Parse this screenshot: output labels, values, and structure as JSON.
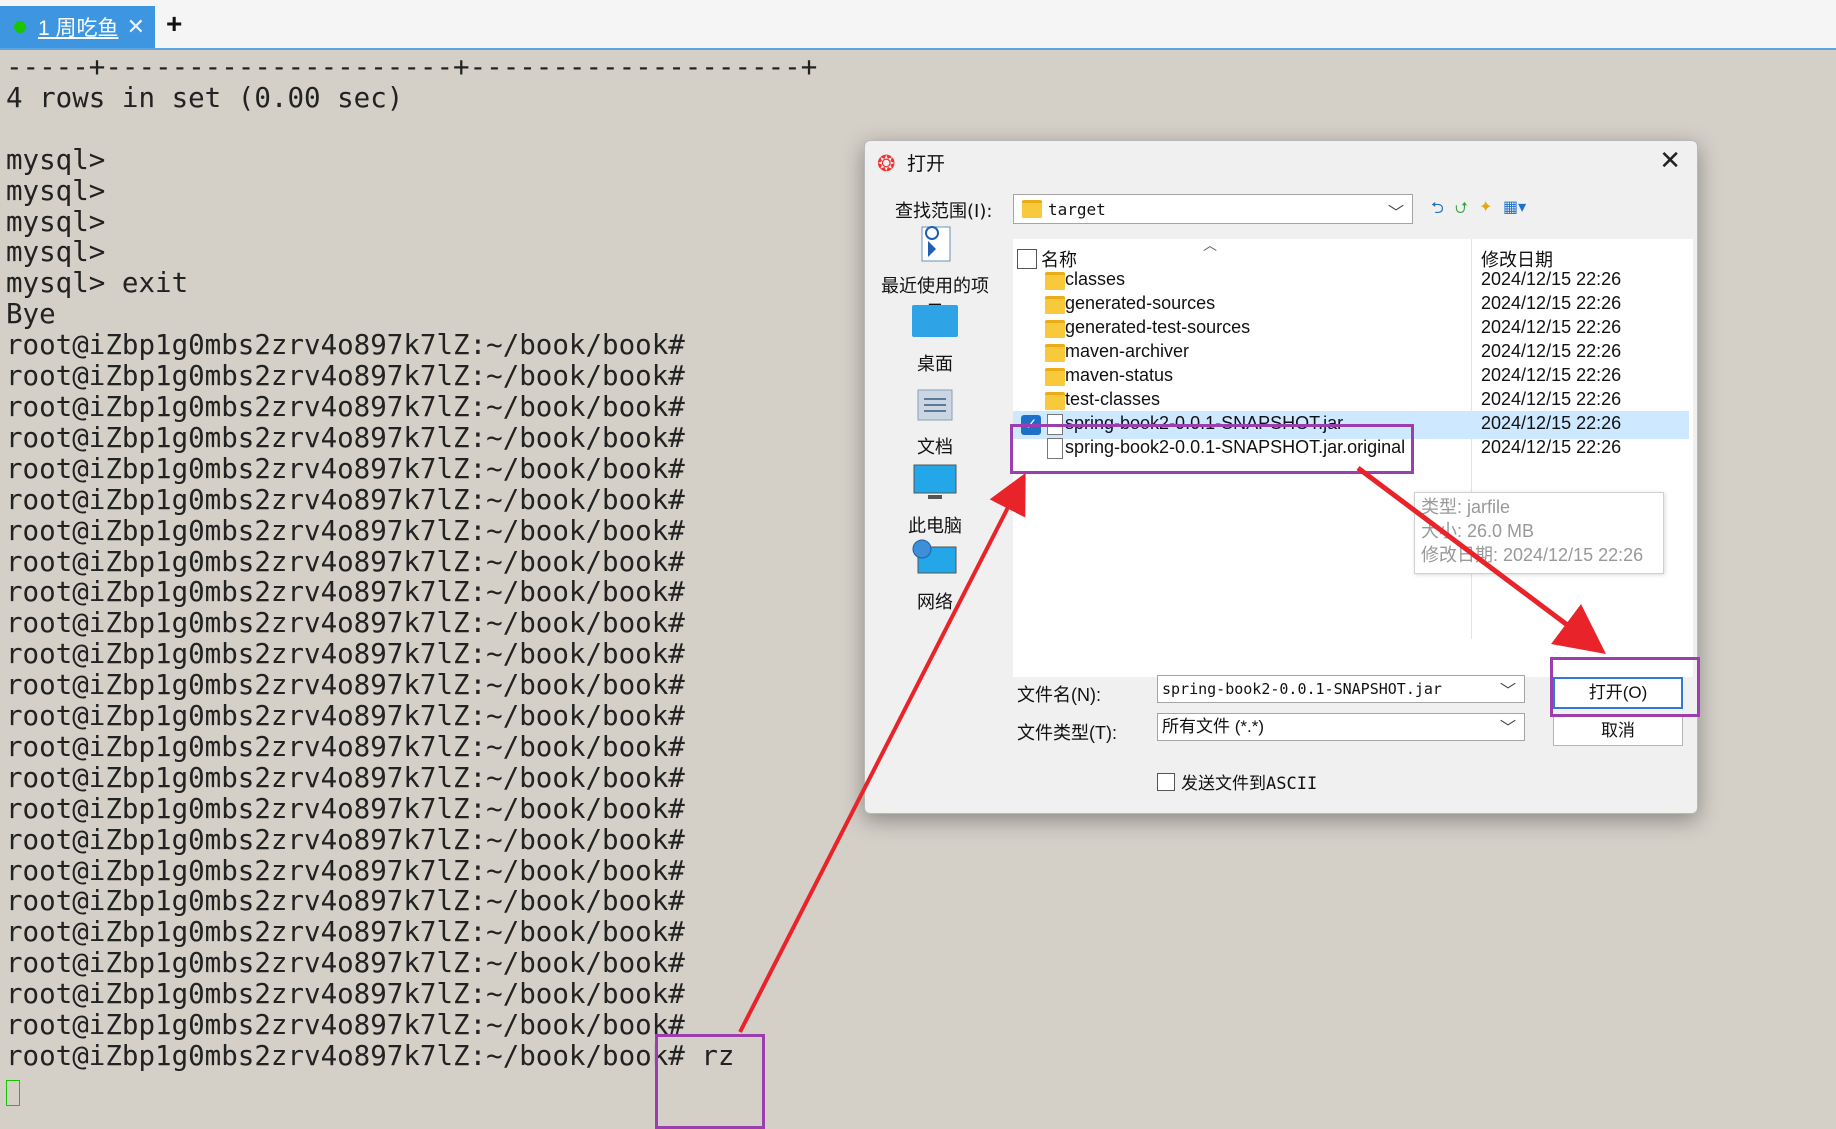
{
  "tab": {
    "label": "1 周吃鱼",
    "close": "✕",
    "add": "+"
  },
  "terminal": {
    "lines": [
      "-----+---------------------+--------------------+",
      "4 rows in set (0.00 sec)",
      "",
      "mysql>",
      "mysql>",
      "mysql>",
      "mysql>",
      "mysql> exit",
      "Bye",
      "root@iZbp1g0mbs2zrv4o897k7lZ:~/book/book#",
      "root@iZbp1g0mbs2zrv4o897k7lZ:~/book/book#",
      "root@iZbp1g0mbs2zrv4o897k7lZ:~/book/book#",
      "root@iZbp1g0mbs2zrv4o897k7lZ:~/book/book#",
      "root@iZbp1g0mbs2zrv4o897k7lZ:~/book/book#",
      "root@iZbp1g0mbs2zrv4o897k7lZ:~/book/book#",
      "root@iZbp1g0mbs2zrv4o897k7lZ:~/book/book#",
      "root@iZbp1g0mbs2zrv4o897k7lZ:~/book/book#",
      "root@iZbp1g0mbs2zrv4o897k7lZ:~/book/book#",
      "root@iZbp1g0mbs2zrv4o897k7lZ:~/book/book#",
      "root@iZbp1g0mbs2zrv4o897k7lZ:~/book/book#",
      "root@iZbp1g0mbs2zrv4o897k7lZ:~/book/book#",
      "root@iZbp1g0mbs2zrv4o897k7lZ:~/book/book#",
      "root@iZbp1g0mbs2zrv4o897k7lZ:~/book/book#",
      "root@iZbp1g0mbs2zrv4o897k7lZ:~/book/book#",
      "root@iZbp1g0mbs2zrv4o897k7lZ:~/book/book#",
      "root@iZbp1g0mbs2zrv4o897k7lZ:~/book/book#",
      "root@iZbp1g0mbs2zrv4o897k7lZ:~/book/book#",
      "root@iZbp1g0mbs2zrv4o897k7lZ:~/book/book#",
      "root@iZbp1g0mbs2zrv4o897k7lZ:~/book/book#",
      "root@iZbp1g0mbs2zrv4o897k7lZ:~/book/book#",
      "root@iZbp1g0mbs2zrv4o897k7lZ:~/book/book#",
      "root@iZbp1g0mbs2zrv4o897k7lZ:~/book/book#",
      "root@iZbp1g0mbs2zrv4o897k7lZ:~/book/book# rz"
    ]
  },
  "dialog": {
    "title": "打开",
    "close": "✕",
    "look_in_label": "查找范围(I):",
    "look_in_value": "target",
    "places": [
      {
        "label": "最近使用的项目",
        "icon": "recent-items-icon"
      },
      {
        "label": "桌面",
        "icon": "desktop-icon"
      },
      {
        "label": "文档",
        "icon": "documents-icon"
      },
      {
        "label": "此电脑",
        "icon": "this-pc-icon"
      },
      {
        "label": "网络",
        "icon": "network-icon"
      }
    ],
    "columns": {
      "name": "名称",
      "date": "修改日期"
    },
    "files": [
      {
        "name": "classes",
        "date": "2024/12/15 22:26",
        "type": "folder"
      },
      {
        "name": "generated-sources",
        "date": "2024/12/15 22:26",
        "type": "folder"
      },
      {
        "name": "generated-test-sources",
        "date": "2024/12/15 22:26",
        "type": "folder"
      },
      {
        "name": "maven-archiver",
        "date": "2024/12/15 22:26",
        "type": "folder"
      },
      {
        "name": "maven-status",
        "date": "2024/12/15 22:26",
        "type": "folder"
      },
      {
        "name": "test-classes",
        "date": "2024/12/15 22:26",
        "type": "folder"
      },
      {
        "name": "spring-book2-0.0.1-SNAPSHOT.jar",
        "date": "2024/12/15 22:26",
        "type": "file",
        "selected": true
      },
      {
        "name": "spring-book2-0.0.1-SNAPSHOT.jar.original",
        "date": "2024/12/15 22:26",
        "type": "file"
      }
    ],
    "tooltip": {
      "type": "类型: jarfile",
      "size": "大小: 26.0 MB",
      "modified": "修改日期: 2024/12/15 22:26"
    },
    "filename_label": "文件名(N):",
    "filename_value": "spring-book2-0.0.1-SNAPSHOT.jar",
    "filetype_label": "文件类型(T):",
    "filetype_value": "所有文件 (*.*)",
    "open_button": "打开(O)",
    "cancel_button": "取消",
    "ascii_label": "发送文件到ASCII"
  },
  "colors": {
    "annotation_box": "#9b3fb0",
    "annotation_arrow": "#e8242a",
    "selection": "#cde8ff"
  }
}
